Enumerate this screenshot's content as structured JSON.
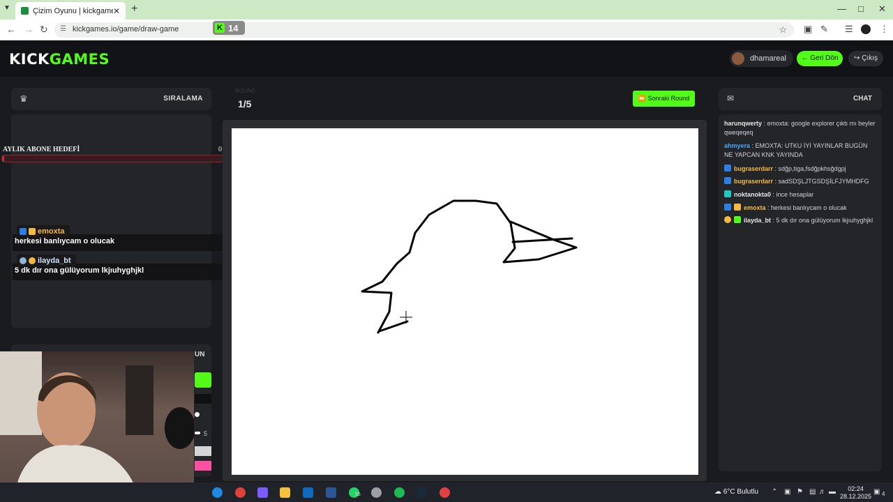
{
  "browser": {
    "tab_title": "Çizim Oyunu | kickgames.io",
    "url": "kickgames.io/game/draw-game",
    "kick_badge": {
      "letter": "K",
      "count": "14"
    }
  },
  "header": {
    "logo_a": "KICK",
    "logo_b": "GAMES",
    "username": "dhamareal",
    "back_button": "Geri Dön",
    "exit_button": "Çıkış"
  },
  "leaderboard": {
    "title": "SIRALAMA"
  },
  "round": {
    "caption": "ROUND",
    "value": "1/5",
    "next_button": "Sonraki Round"
  },
  "tools": {
    "label_fragment": "UN",
    "brush_size": "5"
  },
  "chat": {
    "title": "CHAT",
    "messages": [
      {
        "user": "harunqwerty",
        "text": "emoxta: google explorer çıktı mı beyler qweqeqeq",
        "color": "#e6e6e6"
      },
      {
        "user": "ahmyera",
        "text": "EMOXTA: UTKU İYİ YAYINLAR BUGÜN NE YAPCAN KNK YAYINDA",
        "color": "#4aa8ff"
      },
      {
        "user": "bugraserdarr",
        "text": "sdğp,tiga,fsdğpkhsğdgpj",
        "color": "#f5b942"
      },
      {
        "user": "bugraserdarr",
        "text": "sadSDŞLJTGSDŞİLFJYMHDFG",
        "color": "#f5b942"
      },
      {
        "user": "noktanokta0",
        "text": "ince hesaplar",
        "color": "#e6e6e6"
      },
      {
        "user": "emoxta",
        "text": "herkesi banlıycam o olucak",
        "color": "#f5b942"
      },
      {
        "user": "ilayda_bt",
        "text": "5 dk dır ona gülüyorum lkjıuhyghjkl",
        "color": "#e6e6e6"
      }
    ]
  },
  "overlay": {
    "goal_label": "AYLIK ABONE HEDEFİ",
    "goal_count": "0 /",
    "goal_progress": 0.01,
    "messages": [
      {
        "user": "emoxta",
        "text": "herkesi banlıycam o olucak",
        "color": "#f5b942"
      },
      {
        "user": "ilayda_bt",
        "text": "5 dk dır ona gülüyorum lkjıuhyghjkl",
        "color": "#cfe3ff"
      }
    ]
  },
  "taskbar": {
    "weather": "6°C Bulutlu",
    "time": "02:24",
    "date": "28.12.2025",
    "notif_count": "4",
    "whatsapp_badge": "55"
  },
  "colors": {
    "accent": "#53fc18",
    "goal_bar": "#b3303d",
    "pink_swatch": "#ff4fa3"
  }
}
